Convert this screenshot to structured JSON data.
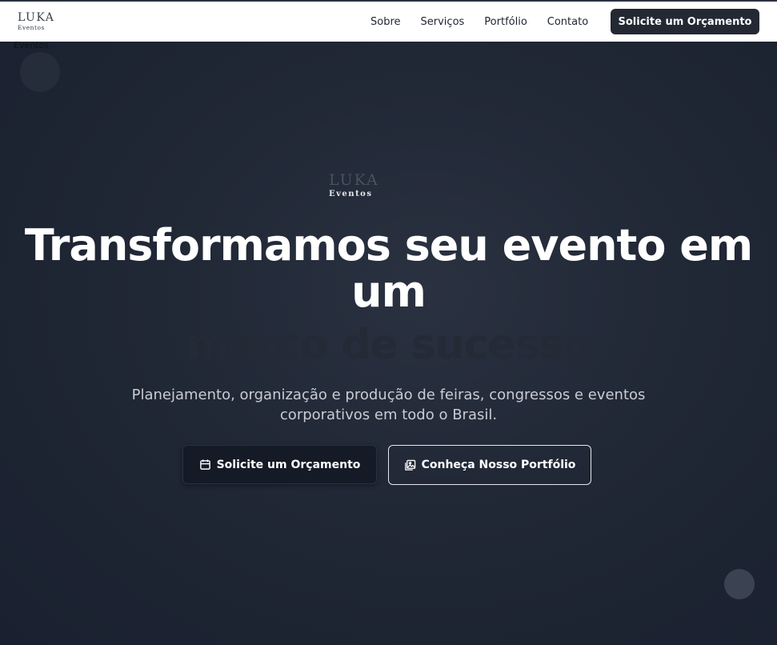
{
  "header": {
    "brand_name": "LUKA",
    "brand_sub": "Eventos",
    "nav": [
      "Sobre",
      "Serviços",
      "Portfólio",
      "Contato"
    ],
    "cta_label": "Solicite um Orçamento"
  },
  "ghost": {
    "brand_text": "Eventos"
  },
  "hero": {
    "logo_name": "LUKA",
    "logo_sub": "Eventos",
    "title_line1": "Transformamos seu evento em",
    "title_line2": "um",
    "highlight": "marco de sucesso",
    "subtitle": "Planejamento, organização e produção de feiras, congressos e eventos corporativos em todo o Brasil.",
    "primary_button": "Solicite um Orçamento",
    "secondary_button": "Conheça Nosso Portfólio"
  },
  "icons": {
    "primary_button_icon": "calendar-icon",
    "secondary_button_icon": "image-gallery-icon"
  },
  "colors": {
    "background": "#1c2331",
    "nav_background": "#ffffff",
    "cta_background": "#232833",
    "title_text": "#ffffff",
    "highlight_text": "#242a36"
  }
}
